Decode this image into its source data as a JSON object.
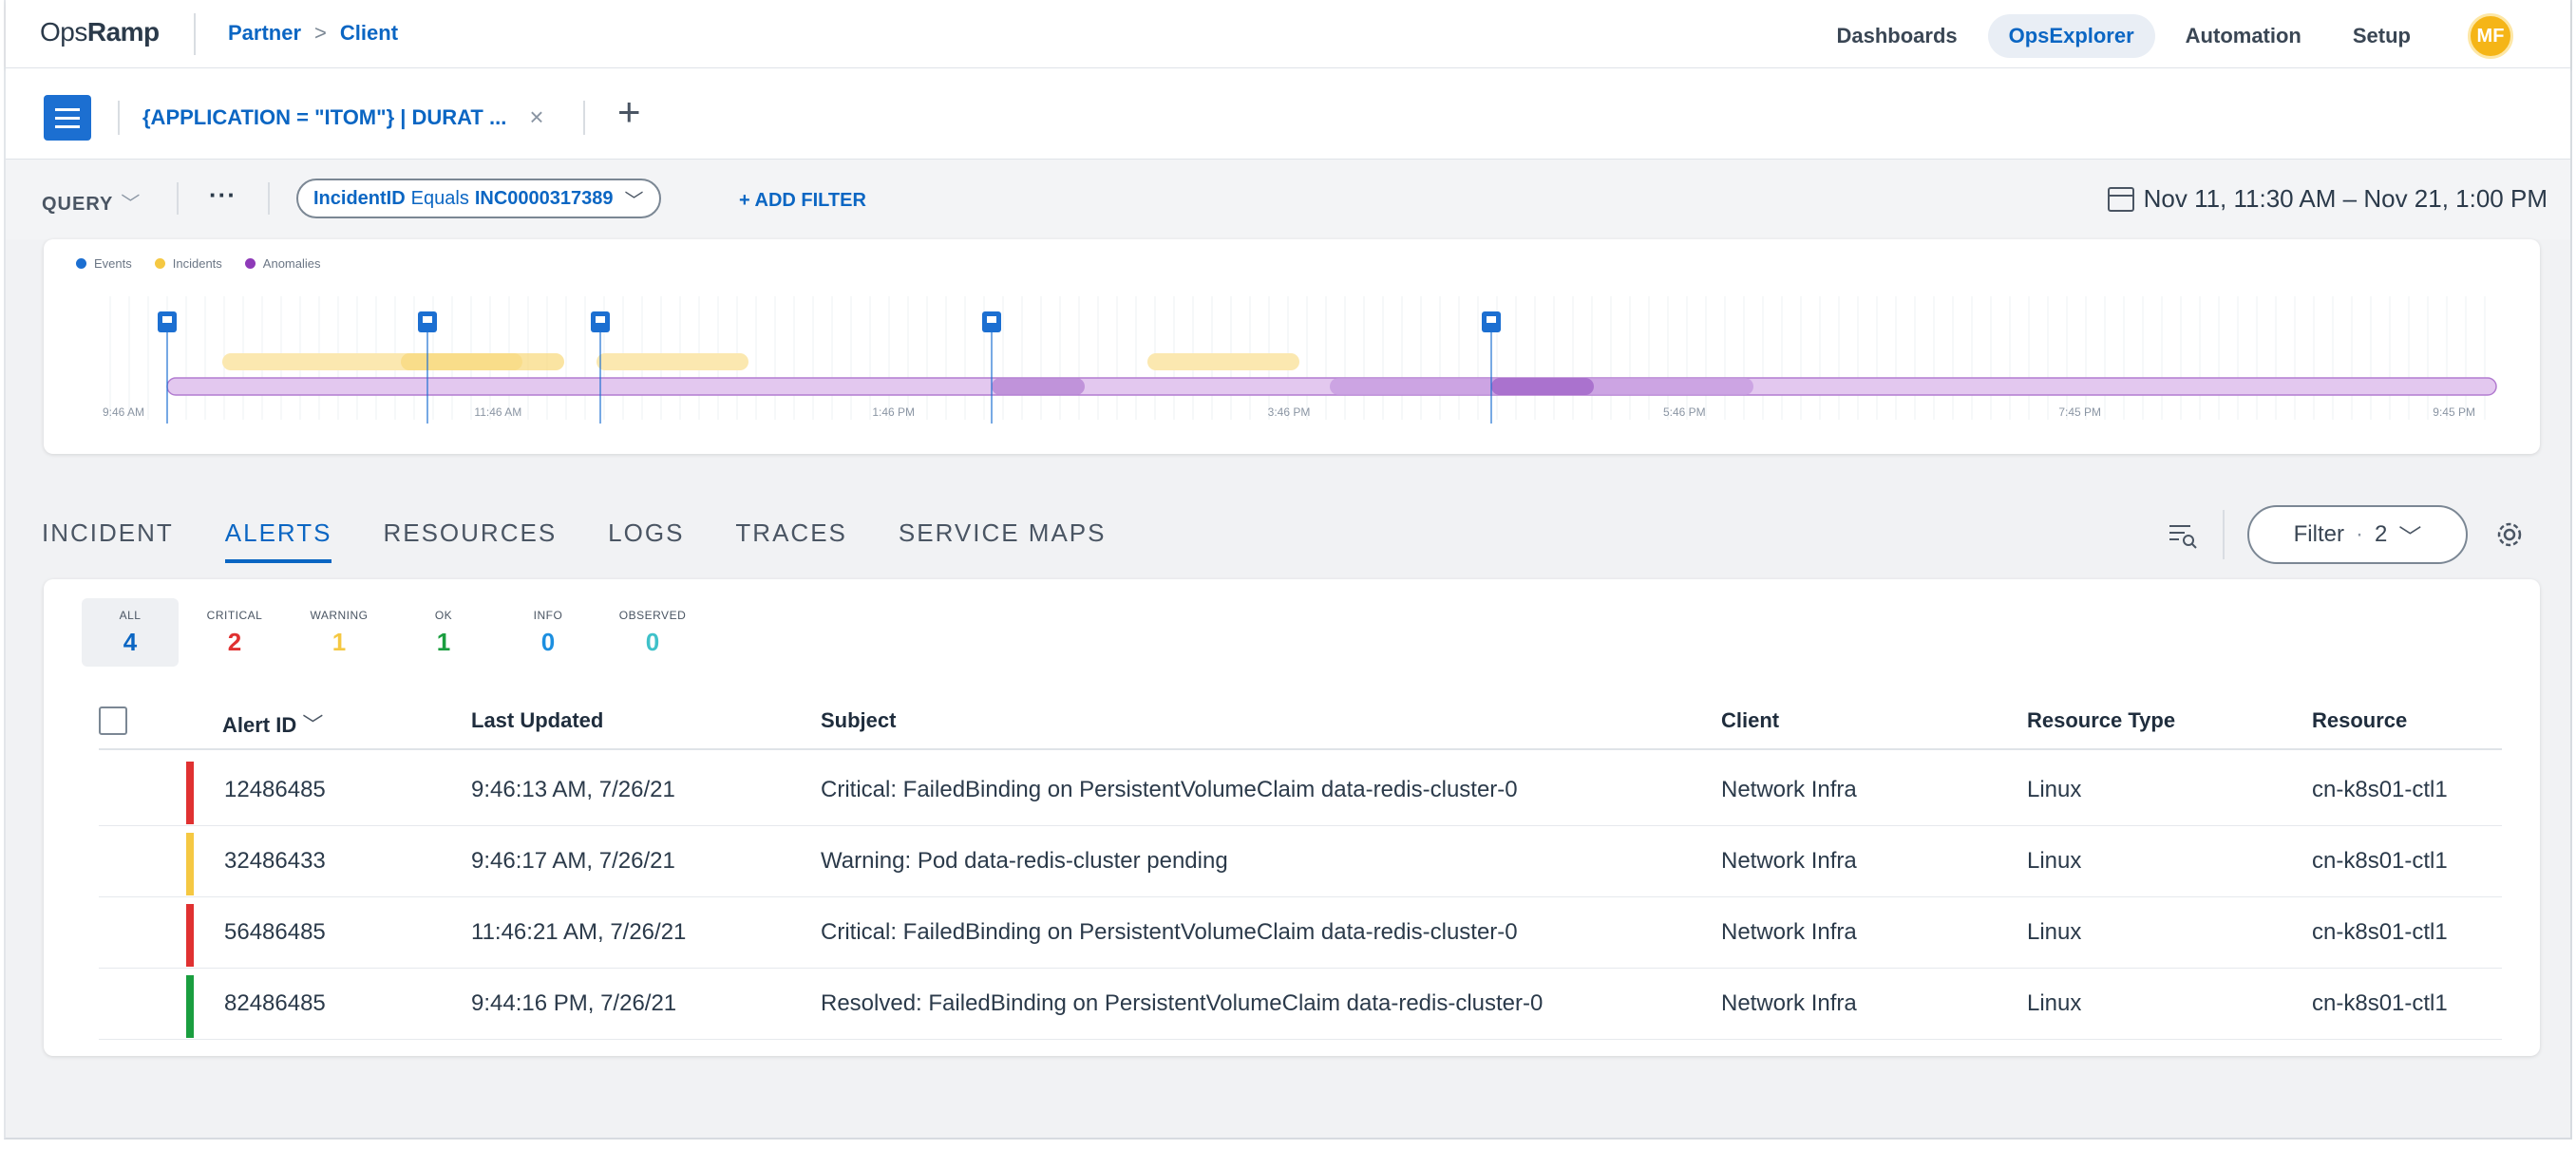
{
  "brand": {
    "logo_prefix": "Ops",
    "logo_suffix": "Ramp"
  },
  "breadcrumb": {
    "partner": "Partner",
    "separator": ">",
    "client": "Client"
  },
  "nav": {
    "dashboards": "Dashboards",
    "opsexplorer": "OpsExplorer",
    "automation": "Automation",
    "setup": "Setup",
    "avatar_initials": "MF"
  },
  "tabbar": {
    "query_tab_label": "{APPLICATION = \"ITOM\"} | DURAT ...",
    "close_glyph": "×",
    "add_glyph": "+"
  },
  "queryrow": {
    "query_label": "QUERY",
    "more": "···",
    "filter_field": "IncidentID",
    "filter_op": "Equals",
    "filter_value": "INC0000317389",
    "add_filter": "+ ADD FILTER",
    "date_range": "Nov 11, 11:30 AM – Nov 21, 1:00 PM"
  },
  "timeline": {
    "legend": [
      {
        "label": "Events",
        "color": "#1c6fd1"
      },
      {
        "label": "Incidents",
        "color": "#f5c842"
      },
      {
        "label": "Anomalies",
        "color": "#8e3ab8"
      }
    ],
    "tick_labels": [
      "9:46 AM",
      "11:46 AM",
      "1:46 PM",
      "3:46 PM",
      "5:46 PM",
      "7:45 PM",
      "9:45 PM"
    ]
  },
  "section_tabs": [
    "INCIDENT",
    "ALERTS",
    "RESOURCES",
    "LOGS",
    "TRACES",
    "SERVICE MAPS"
  ],
  "active_section_tab": "ALERTS",
  "filter_button": {
    "label": "Filter",
    "count": "2"
  },
  "counts": [
    {
      "label": "ALL",
      "value": "4",
      "color": "#0b66c3"
    },
    {
      "label": "CRITICAL",
      "value": "2",
      "color": "#e03131"
    },
    {
      "label": "WARNING",
      "value": "1",
      "color": "#f5c842"
    },
    {
      "label": "OK",
      "value": "1",
      "color": "#1a9e3f"
    },
    {
      "label": "INFO",
      "value": "0",
      "color": "#1c8fe0"
    },
    {
      "label": "OBSERVED",
      "value": "0",
      "color": "#3fc1c9"
    }
  ],
  "table": {
    "columns": [
      "Alert ID",
      "Last Updated",
      "Subject",
      "Client",
      "Resource Type",
      "Resource"
    ],
    "rows": [
      {
        "severity_color": "#e03131",
        "alert_id": "12486485",
        "last_updated": "9:46:13 AM, 7/26/21",
        "subject": "Critical: FailedBinding on PersistentVolumeClaim data-redis-cluster-0",
        "client": "Network Infra",
        "resource_type": "Linux",
        "resource": "cn-k8s01-ctl1"
      },
      {
        "severity_color": "#f5c842",
        "alert_id": "32486433",
        "last_updated": "9:46:17 AM, 7/26/21",
        "subject": "Warning: Pod data-redis-cluster pending",
        "client": "Network Infra",
        "resource_type": "Linux",
        "resource": "cn-k8s01-ctl1"
      },
      {
        "severity_color": "#e03131",
        "alert_id": "56486485",
        "last_updated": "11:46:21 AM, 7/26/21",
        "subject": "Critical: FailedBinding on PersistentVolumeClaim data-redis-cluster-0",
        "client": "Network Infra",
        "resource_type": "Linux",
        "resource": "cn-k8s01-ctl1"
      },
      {
        "severity_color": "#1a9e3f",
        "alert_id": "82486485",
        "last_updated": "9:44:16 PM, 7/26/21",
        "subject": "Resolved: FailedBinding on PersistentVolumeClaim data-redis-cluster-0",
        "client": "Network Infra",
        "resource_type": "Linux",
        "resource": "cn-k8s01-ctl1"
      }
    ]
  }
}
